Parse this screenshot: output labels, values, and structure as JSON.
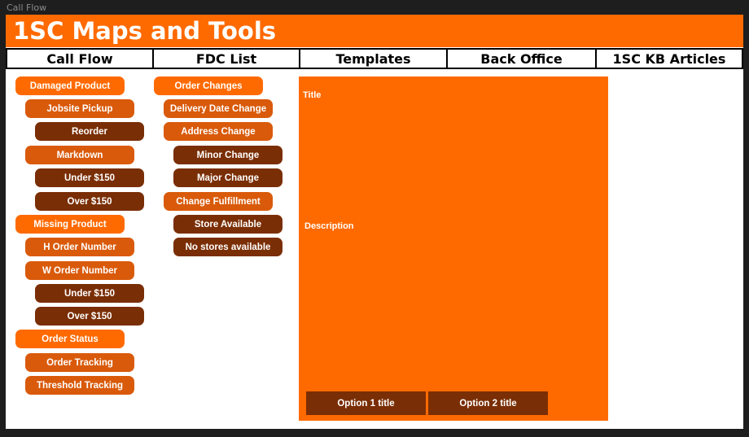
{
  "window": {
    "frame_label": "Call Flow"
  },
  "header": {
    "title": "1SC Maps and Tools",
    "color": "#ff6a00"
  },
  "nav": {
    "tabs": [
      {
        "label": "Call Flow"
      },
      {
        "label": "FDC List"
      },
      {
        "label": "Templates"
      },
      {
        "label": "Back Office"
      },
      {
        "label": "1SC KB Articles"
      }
    ]
  },
  "call_flow": {
    "items": [
      {
        "label": "Damaged Product",
        "level": 1
      },
      {
        "label": "Jobsite Pickup",
        "level": 2
      },
      {
        "label": "Reorder",
        "level": 3
      },
      {
        "label": "Markdown",
        "level": 2
      },
      {
        "label": "Under $150",
        "level": 3
      },
      {
        "label": "Over $150",
        "level": 3
      },
      {
        "label": "Missing Product",
        "level": 1
      },
      {
        "label": "H Order Number",
        "level": 2
      },
      {
        "label": "W Order Number",
        "level": 2
      },
      {
        "label": "Under $150",
        "level": 3
      },
      {
        "label": "Over $150",
        "level": 3
      },
      {
        "label": "Order Status",
        "level": 1
      },
      {
        "label": "Order Tracking",
        "level": 2
      },
      {
        "label": "Threshold Tracking",
        "level": 2
      }
    ]
  },
  "fdc_list": {
    "items": [
      {
        "label": "Order Changes",
        "level": 1
      },
      {
        "label": "Delivery Date Change",
        "level": 2
      },
      {
        "label": "Address Change",
        "level": 2
      },
      {
        "label": "Minor Change",
        "level": 3
      },
      {
        "label": "Major Change",
        "level": 3
      },
      {
        "label": "Change Fulfillment",
        "level": 2
      },
      {
        "label": "Store Available",
        "level": 3
      },
      {
        "label": "No stores available",
        "level": 3
      }
    ]
  },
  "detail_panel": {
    "title": "Title",
    "description": "Description",
    "option1": "Option 1 title",
    "option2": "Option 2 title"
  },
  "colors": {
    "level1": "#ff6a00",
    "level2": "#d95a0a",
    "level3": "#7a2e05",
    "background": "#1e1e1e"
  }
}
